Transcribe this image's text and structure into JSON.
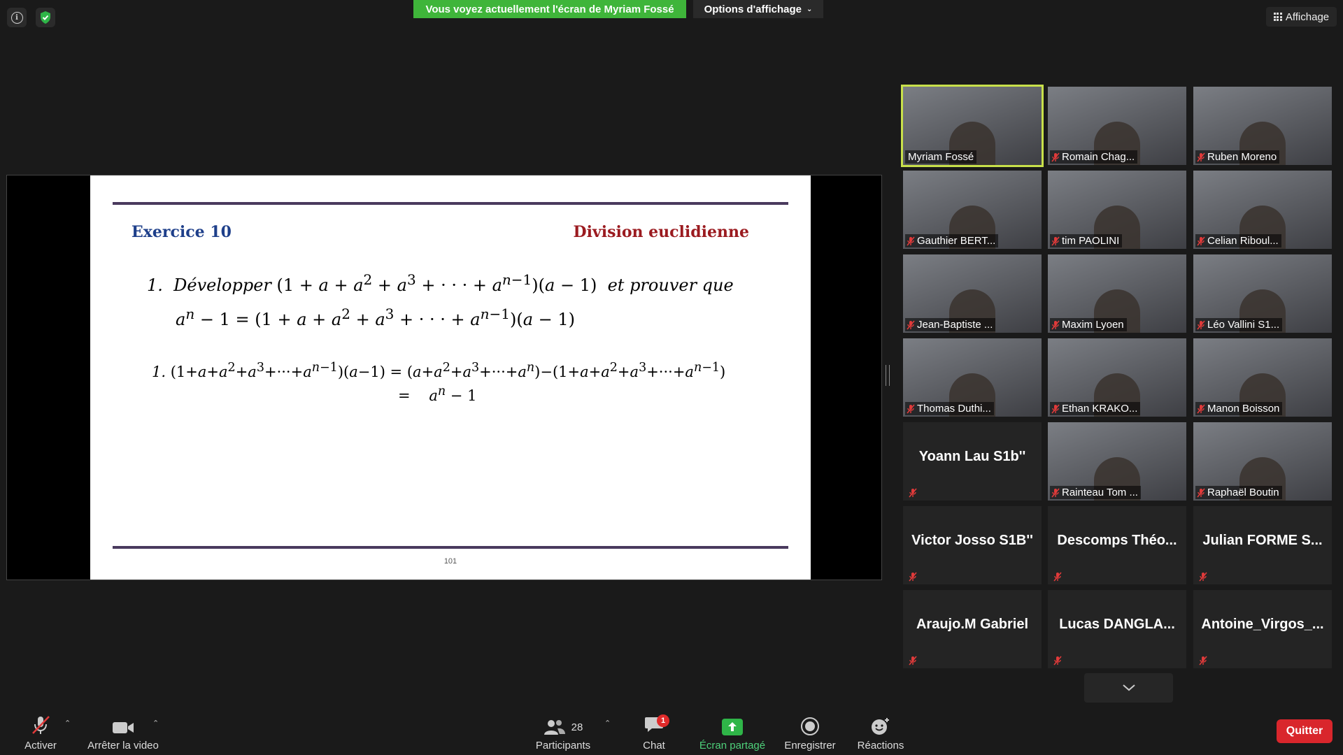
{
  "banner": {
    "sharing_text": "Vous voyez actuellement l'écran de Myriam Fossé",
    "view_options_label": "Options d'affichage",
    "affichage_label": "Affichage"
  },
  "slide": {
    "exercise_title": "Exercice 10",
    "topic": "Division euclidienne",
    "page_number": "101",
    "q_label": "1.",
    "q_develop": "Développer",
    "q_and_prove": "et prouver que",
    "a_label": "1.",
    "a_equals_sign": "="
  },
  "participants": [
    {
      "name": "Myriam Fossé",
      "muted": false,
      "video": true,
      "active": true
    },
    {
      "name": "Romain Chag...",
      "muted": true,
      "video": true
    },
    {
      "name": "Ruben Moreno",
      "muted": true,
      "video": true
    },
    {
      "name": "Gauthier BERT...",
      "muted": true,
      "video": true
    },
    {
      "name": "tim PAOLINI",
      "muted": true,
      "video": true
    },
    {
      "name": "Celian Riboul...",
      "muted": true,
      "video": true
    },
    {
      "name": "Jean-Baptiste ...",
      "muted": true,
      "video": true
    },
    {
      "name": "Maxim Lyoen",
      "muted": true,
      "video": true
    },
    {
      "name": "Léo Vallini S1...",
      "muted": true,
      "video": true
    },
    {
      "name": "Thomas Duthi...",
      "muted": true,
      "video": true
    },
    {
      "name": "Ethan KRAKO...",
      "muted": true,
      "video": true
    },
    {
      "name": "Manon Boisson",
      "muted": true,
      "video": true
    },
    {
      "name": "Yoann Lau S1b''",
      "muted": true,
      "video": false
    },
    {
      "name": "Rainteau Tom ...",
      "muted": true,
      "video": true
    },
    {
      "name": "Raphaël Boutin",
      "muted": true,
      "video": true
    },
    {
      "name": "Victor Josso S1B''",
      "muted": true,
      "video": false
    },
    {
      "name": "Descomps  Théo...",
      "muted": true,
      "video": false
    },
    {
      "name": "Julian  FORME  S...",
      "muted": true,
      "video": false
    },
    {
      "name": "Araujo.M Gabriel",
      "muted": true,
      "video": false
    },
    {
      "name": "Lucas  DANGLA...",
      "muted": true,
      "video": false
    },
    {
      "name": "Antoine_Virgos_...",
      "muted": true,
      "video": false
    }
  ],
  "toolbar": {
    "mute_label": "Activer",
    "video_label": "Arrêter la video",
    "participants_label": "Participants",
    "participants_count": "28",
    "chat_label": "Chat",
    "chat_badge": "1",
    "share_label": "Écran partagé",
    "record_label": "Enregistrer",
    "reactions_label": "Réactions",
    "quit_label": "Quitter"
  },
  "colors": {
    "banner_green": "#3fb53a",
    "share_icon_green": "#2fb548",
    "active_speaker": "#c8e04a",
    "quit_red": "#d9262c",
    "muted_red": "#e03a3a",
    "exercise_blue": "#1e3f8a",
    "topic_red": "#9b1b20"
  },
  "icons": {
    "info": "info-icon",
    "security": "shield-check-icon",
    "grid": "grid-icon",
    "mic_muted": "microphone-muted-icon",
    "camera": "video-camera-icon",
    "participants": "people-icon",
    "chat": "chat-bubble-icon",
    "share": "share-screen-arrow-icon",
    "record": "record-icon",
    "reactions": "smiley-plus-icon"
  }
}
